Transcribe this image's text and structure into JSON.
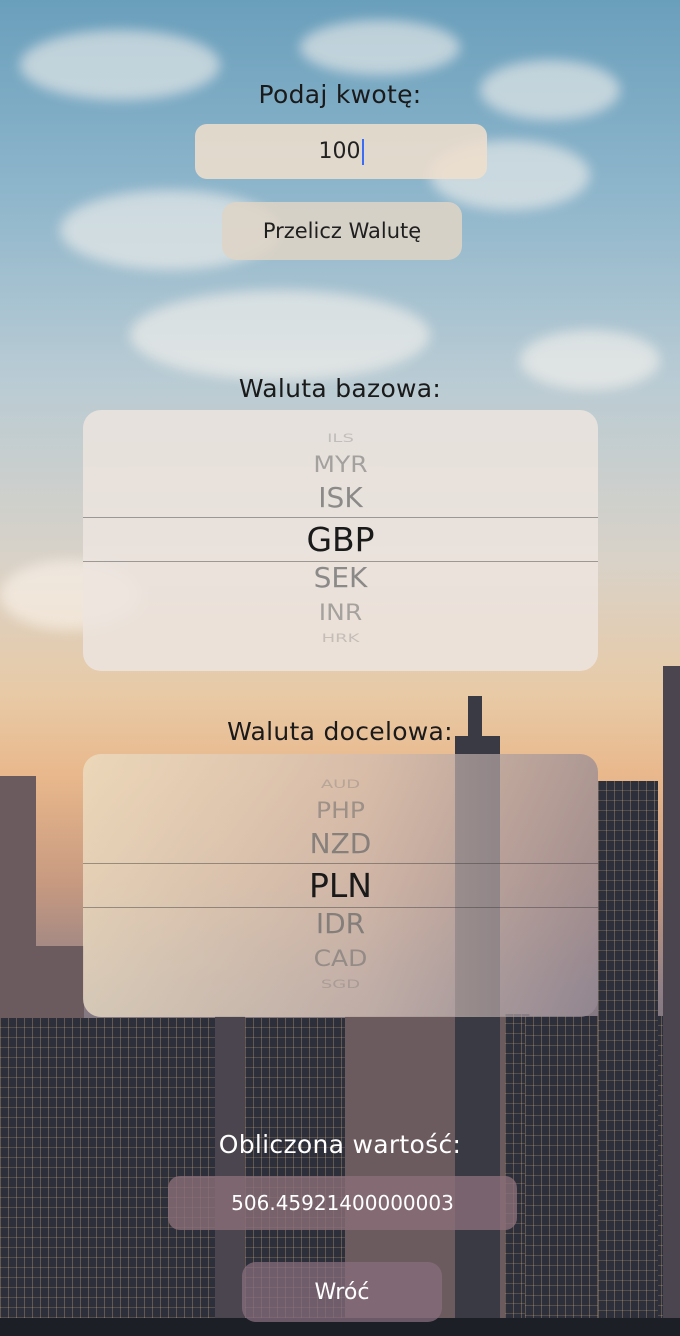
{
  "amount": {
    "label": "Podaj kwotę:",
    "value": "100"
  },
  "convert_button": "Przelicz Walutę",
  "base": {
    "label": "Waluta bazowa:",
    "items": [
      "ILS",
      "MYR",
      "ISK",
      "GBP",
      "SEK",
      "INR",
      "HRK"
    ],
    "selected": "GBP"
  },
  "target": {
    "label": "Waluta docelowa:",
    "items": [
      "AUD",
      "PHP",
      "NZD",
      "PLN",
      "IDR",
      "CAD",
      "SGD"
    ],
    "selected": "PLN"
  },
  "result": {
    "label": "Obliczona wartość:",
    "value": "506.45921400000003"
  },
  "back_button": "Wróć"
}
